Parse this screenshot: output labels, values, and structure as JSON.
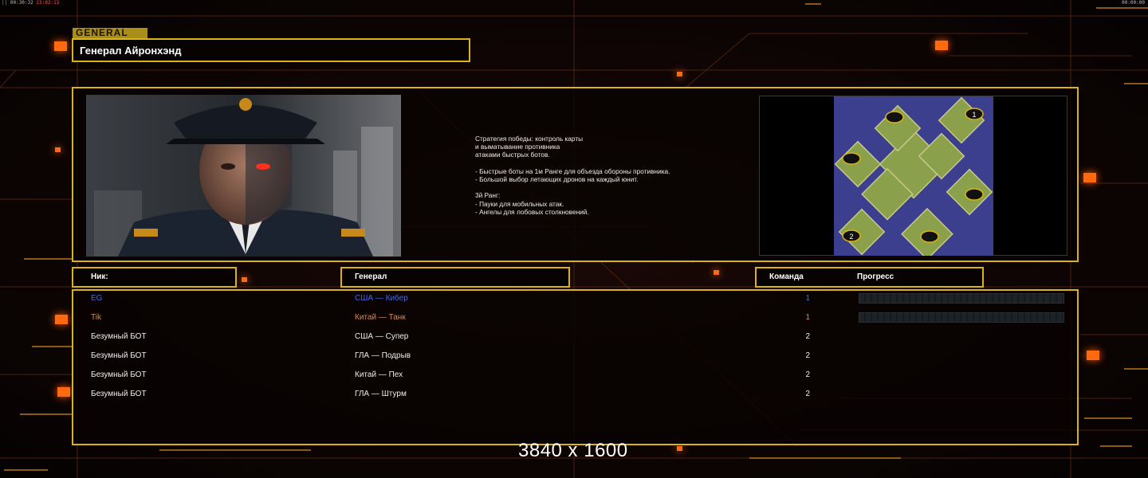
{
  "status": {
    "top_left": "00:30:32",
    "top_left_fps": "||",
    "top_left_clock": "23:02:13",
    "top_right": "00:00:00"
  },
  "header": {
    "tag": "GENERAL",
    "title": "Генерал Айронхэнд"
  },
  "description": {
    "lines": [
      "Стратегия победы: контроль карты",
      "и выматывание противника",
      "атаками быстрых ботов.",
      "",
      "- Быстрые боты на 1м Ранге для объезда обороны противника.",
      "- Большой выбор летающих дронов на каждый юнит.",
      "",
      "3й Ранг:",
      "- Пауки для мобильных атак.",
      "- Ангелы для лобовых столкновений."
    ]
  },
  "map": {
    "spawn_labels": [
      "1",
      "2"
    ]
  },
  "columns": {
    "nick": "Ник:",
    "general": "Генерал",
    "team": "Команда",
    "progress": "Прогресс"
  },
  "players": [
    {
      "nick": "EG",
      "general": "США — Кибер",
      "team": "1",
      "color": "#4a63e8",
      "has_progress": true
    },
    {
      "nick": "Tik",
      "general": "Китай — Танк",
      "team": "1",
      "color": "#d78a57",
      "has_progress": true
    },
    {
      "nick": "Безумный БОТ",
      "general": "США — Супер",
      "team": "2",
      "color": "#f0ece6",
      "has_progress": false
    },
    {
      "nick": "Безумный БОТ",
      "general": "ГЛА — Подрыв",
      "team": "2",
      "color": "#f0ece6",
      "has_progress": false
    },
    {
      "nick": "Безумный БОТ",
      "general": "Китай — Пех",
      "team": "2",
      "color": "#f0ece6",
      "has_progress": false
    },
    {
      "nick": "Безумный БОТ",
      "general": "ГЛА — Штурм",
      "team": "2",
      "color": "#f0ece6",
      "has_progress": false
    }
  ],
  "footer": {
    "resolution": "3840 x 1600"
  },
  "colors": {
    "frame": "#d9b318",
    "accent": "#ff6a10"
  }
}
